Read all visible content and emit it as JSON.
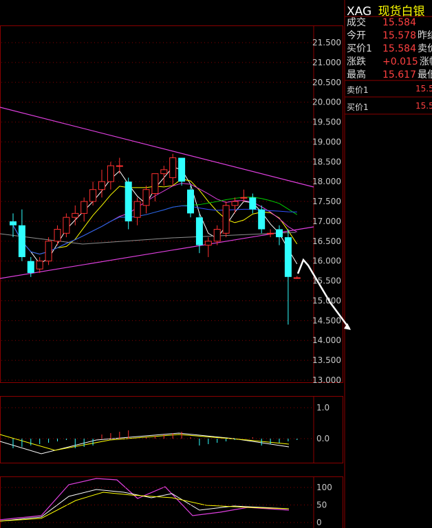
{
  "header": {
    "symbol": "XAG",
    "name": "现货白银"
  },
  "quote": {
    "rows": [
      {
        "label": "成交",
        "value": "15.584",
        "next": ""
      },
      {
        "label": "今开",
        "value": "15.578",
        "next": "昨结"
      },
      {
        "label": "买价1",
        "value": "15.584",
        "next": "卖价"
      },
      {
        "label": "涨跌",
        "value": "+0.015",
        "next": "涨幅"
      },
      {
        "label": "最高",
        "value": "15.617",
        "next": "最低"
      }
    ],
    "ask_label": "卖价1",
    "ask_value": "15.5",
    "bid_label": "买价1",
    "bid_value": "15.5"
  },
  "colors": {
    "up": "#ff3030",
    "down": "#30ffff",
    "grid": "#8b0000",
    "axis_text": "#c8c8c8"
  },
  "chart_data": [
    {
      "type": "candlestick",
      "y_ticks": [
        "21.500",
        "21.000",
        "20.500",
        "20.000",
        "19.500",
        "19.000",
        "18.500",
        "18.000",
        "17.500",
        "17.000",
        "16.500",
        "16.000",
        "15.500",
        "15.000",
        "14.500",
        "14.000",
        "13.500",
        "13.000"
      ],
      "ylim": [
        13.0,
        22.0
      ],
      "candles": [
        {
          "o": 17.0,
          "h": 17.2,
          "l": 16.6,
          "c": 16.9
        },
        {
          "o": 16.9,
          "h": 17.3,
          "l": 16.0,
          "c": 16.1
        },
        {
          "o": 16.0,
          "h": 16.1,
          "l": 15.6,
          "c": 15.7
        },
        {
          "o": 15.8,
          "h": 16.1,
          "l": 15.7,
          "c": 16.0
        },
        {
          "o": 16.0,
          "h": 16.6,
          "l": 15.9,
          "c": 16.5
        },
        {
          "o": 16.5,
          "h": 16.9,
          "l": 16.4,
          "c": 16.8
        },
        {
          "o": 16.7,
          "h": 17.2,
          "l": 16.6,
          "c": 17.1
        },
        {
          "o": 17.1,
          "h": 17.4,
          "l": 16.9,
          "c": 17.2
        },
        {
          "o": 17.2,
          "h": 17.6,
          "l": 17.0,
          "c": 17.5
        },
        {
          "o": 17.5,
          "h": 18.0,
          "l": 17.4,
          "c": 17.8
        },
        {
          "o": 17.8,
          "h": 18.3,
          "l": 17.6,
          "c": 18.0
        },
        {
          "o": 18.0,
          "h": 18.5,
          "l": 17.8,
          "c": 18.4
        },
        {
          "o": 18.4,
          "h": 18.6,
          "l": 18.2,
          "c": 18.4
        },
        {
          "o": 18.0,
          "h": 18.1,
          "l": 16.8,
          "c": 17.0
        },
        {
          "o": 17.1,
          "h": 17.6,
          "l": 16.9,
          "c": 17.5
        },
        {
          "o": 17.4,
          "h": 17.9,
          "l": 17.2,
          "c": 17.8
        },
        {
          "o": 17.7,
          "h": 18.2,
          "l": 17.5,
          "c": 18.2
        },
        {
          "o": 18.2,
          "h": 18.4,
          "l": 17.9,
          "c": 18.3
        },
        {
          "o": 18.1,
          "h": 18.7,
          "l": 17.9,
          "c": 18.6
        },
        {
          "o": 18.6,
          "h": 18.6,
          "l": 17.9,
          "c": 18.0
        },
        {
          "o": 17.8,
          "h": 17.9,
          "l": 17.1,
          "c": 17.2
        },
        {
          "o": 17.1,
          "h": 17.2,
          "l": 16.2,
          "c": 16.4
        },
        {
          "o": 16.4,
          "h": 16.6,
          "l": 16.1,
          "c": 16.5
        },
        {
          "o": 16.5,
          "h": 16.9,
          "l": 16.4,
          "c": 16.8
        },
        {
          "o": 16.7,
          "h": 17.5,
          "l": 16.6,
          "c": 17.4
        },
        {
          "o": 17.4,
          "h": 17.6,
          "l": 17.2,
          "c": 17.5
        },
        {
          "o": 17.6,
          "h": 17.8,
          "l": 17.5,
          "c": 17.6
        },
        {
          "o": 17.6,
          "h": 17.7,
          "l": 17.2,
          "c": 17.3
        },
        {
          "o": 17.3,
          "h": 17.4,
          "l": 16.7,
          "c": 16.8
        },
        {
          "o": 16.7,
          "h": 16.8,
          "l": 16.6,
          "c": 16.7
        },
        {
          "o": 16.8,
          "h": 16.9,
          "l": 16.4,
          "c": 16.6
        },
        {
          "o": 16.6,
          "h": 16.8,
          "l": 14.4,
          "c": 15.6
        },
        {
          "o": 15.58,
          "h": 15.62,
          "l": 15.55,
          "c": 15.58
        }
      ]
    },
    {
      "type": "bar",
      "y_ticks": [
        "1.0",
        "0.0"
      ],
      "ylim": [
        -1.0,
        1.4
      ]
    },
    {
      "type": "line",
      "y_ticks": [
        "100",
        "50",
        "0"
      ],
      "ylim": [
        0,
        130
      ]
    }
  ]
}
